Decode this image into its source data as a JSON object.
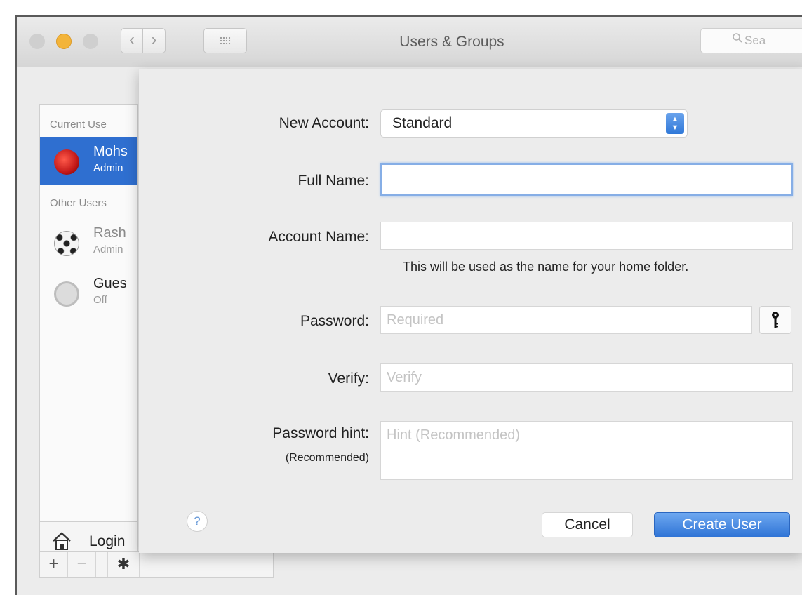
{
  "window": {
    "title": "Users & Groups",
    "search_placeholder": "Sea",
    "search_icon": "search-icon",
    "traffic_lights": [
      "close",
      "minimize",
      "zoom"
    ],
    "nav_back": "‹",
    "nav_forward": "›"
  },
  "sidebar": {
    "current_users_header": "Current Use",
    "other_users_header": "Other Users",
    "users": [
      {
        "name": "Mohs",
        "role": "Admin",
        "selected": true
      },
      {
        "name": "Rash",
        "role": "Admin",
        "selected": false
      },
      {
        "name": "Gues",
        "role": "Off",
        "selected": false
      }
    ],
    "login_label": "Login",
    "toolbar": {
      "add": "+",
      "remove": "−",
      "gear": "✱"
    }
  },
  "sheet": {
    "new_account_label": "New Account:",
    "new_account_value": "Standard",
    "full_name_label": "Full Name:",
    "full_name_value": "",
    "account_name_label": "Account Name:",
    "account_name_value": "",
    "account_name_help": "This will be used as the name for your home folder.",
    "password_label": "Password:",
    "password_placeholder": "Required",
    "verify_label": "Verify:",
    "verify_placeholder": "Verify",
    "hint_label": "Password hint:",
    "hint_sublabel": "(Recommended)",
    "hint_placeholder": "Hint (Recommended)",
    "help_button": "?",
    "cancel_label": "Cancel",
    "create_label": "Create User"
  },
  "colors": {
    "accent": "#2f74d6",
    "selection": "#2f6fd0",
    "focus_ring": "#86aee6",
    "minimize": "#f3b43a"
  }
}
